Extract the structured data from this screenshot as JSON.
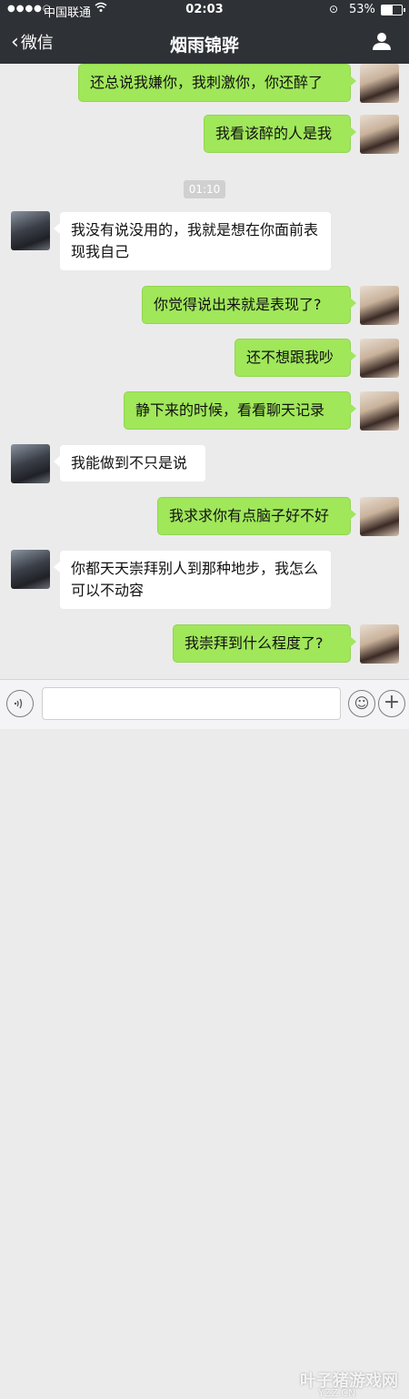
{
  "status_bar": {
    "signal": "●●●●○",
    "carrier": "中国联通",
    "time": "02:03",
    "battery_percent": "53%",
    "battery_level": 0.53
  },
  "nav": {
    "back_label": "微信",
    "title": "烟雨锦骅"
  },
  "messages": [
    {
      "from": "me",
      "text": "还总说我嫌你，我刺激你，你还醉了"
    },
    {
      "from": "me",
      "text": "我看该醉的人是我"
    },
    {
      "from": "peer",
      "text": "我没有说没用的，我就是想在你面前表现我自己"
    },
    {
      "from": "me",
      "text": "你觉得说出来就是表现了?"
    },
    {
      "from": "me",
      "text": "还不想跟我吵"
    },
    {
      "from": "me",
      "text": "静下来的时候，看看聊天记录"
    },
    {
      "from": "peer",
      "text": "我能做到不只是说"
    },
    {
      "from": "me",
      "text": "我求求你有点脑子好不好"
    },
    {
      "from": "peer",
      "text": "你都天天崇拜别人到那种地步，我怎么可以不动容"
    },
    {
      "from": "me",
      "text": "我崇拜到什么程度了?"
    }
  ],
  "timestamp": "01:10",
  "input_bar": {
    "placeholder": "",
    "voice_icon": "voice-icon",
    "emoji_icon": "emoji-icon",
    "plus_icon": "plus-icon"
  },
  "watermark": {
    "text": "叶子猪游戏网",
    "url": "YZZ.CN"
  },
  "colors": {
    "nav_bg": "#2e3135",
    "bubble_me": "#a0e75a",
    "bubble_peer": "#ffffff",
    "chat_bg": "#ebebeb"
  }
}
